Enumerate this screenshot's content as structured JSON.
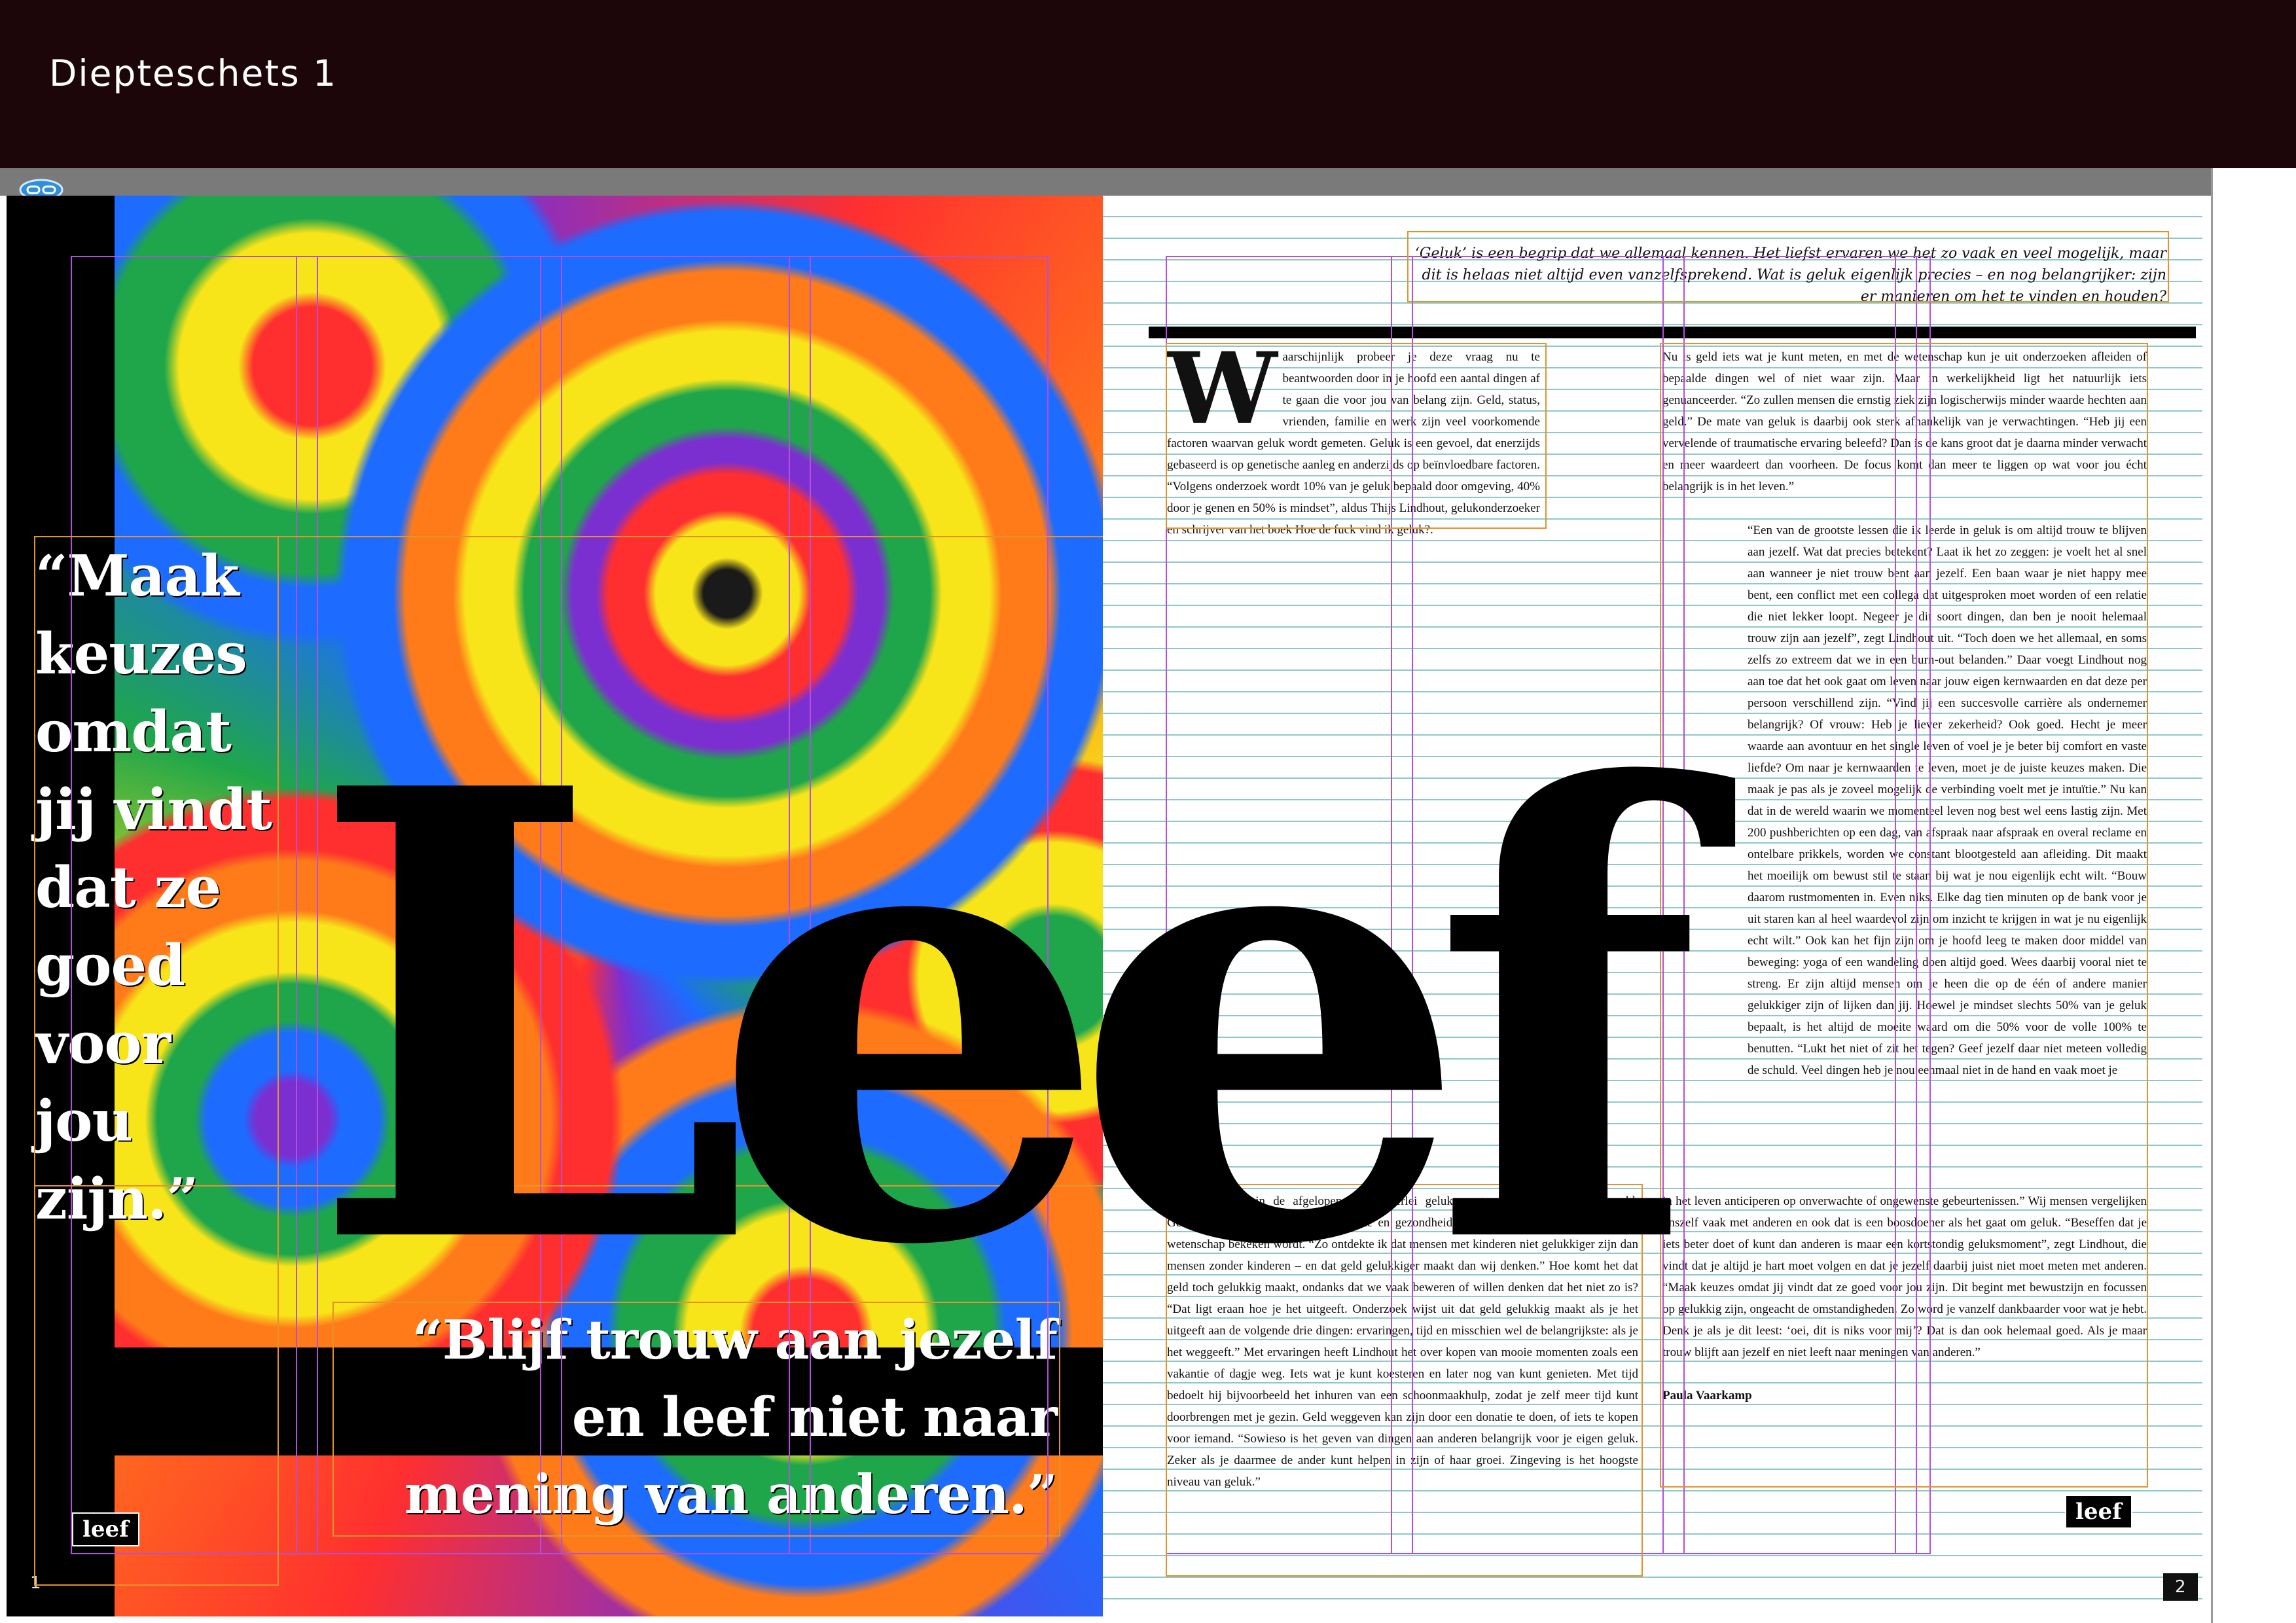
{
  "window": {
    "title": "Diepteschets 1"
  },
  "colors": {
    "titlebar": "#1d0609",
    "guide_purple": "#b04fe0",
    "guide_orange": "#e3932b",
    "baseline_grid": "#8fc8c8"
  },
  "icons": {
    "link": "link-icon"
  },
  "left_page": {
    "quote": "“Maak keuzes omdat jij vindt dat ze goed voor jou zijn.”",
    "quote_bottom": "“Blijf trouw aan jezelf en leef niet naar mening van anderen.”",
    "logo": "leef",
    "page_number": "1"
  },
  "spread": {
    "big_word": "Leef"
  },
  "right_page": {
    "intro": "‘Geluk’ is een begrip dat we allemaal kennen. Het liefst ervaren we het zo vaak en veel mogelijk, maar dit is helaas niet altijd even vanzelfsprekend. Wat is geluk eigenlijk precies – en nog belangrijker: zijn er manieren om het te vinden en houden?",
    "dropcap": "W",
    "col1_top": "aarschijnlijk probeer je deze vraag nu te beantwoorden door in je hoofd een aantal dingen af te gaan die voor jou van belang zijn. Geld, status, vrienden, familie en werk zijn veel voorkomende factoren waarvan geluk wordt gemeten. Geluk is een gevoel, dat enerzijds gebaseerd is op genetische aanleg en anderzijds op beïnvloedbare factoren. “Volgens onderzoek wordt 10% van je geluk bepaald door omgeving, 40% door je genen en 50% is mindset”, aldus Thijs Lindhout, gelukonderzoeker en schrijver van het boek Hoe de fuck vind ik geluk?.",
    "col2_top": "Nu is geld iets wat je kunt meten, en met de wetenschap kun je uit onderzoeken afleiden of bepaalde dingen wel of niet waar zijn. Maar in werkelijkheid ligt het natuurlijk iets genuanceerder. “Zo zullen mensen die ernstig ziek zijn logischerwijs minder waarde hechten aan geld.” De mate van geluk is daarbij ook sterk afhankelijk van je verwachtingen. “Heb jij een vervelende of traumatische ervaring beleefd? Dan is de kans groot dat je daarna minder verwacht en meer waardeert dan voorheen. De focus komt dan meer te liggen op wat voor jou écht belangrijk is in het leven.”",
    "col2_mid": "“Een van de grootste lessen die ik leerde in geluk is om altijd trouw te blijven aan jezelf. Wat dat precies betekent? Laat ik het zo zeggen: je voelt het al snel aan wanneer je niet trouw bent aan jezelf. Een baan waar je niet happy mee bent, een conflict met een collega dat uitgesproken moet worden of een relatie die niet lekker loopt. Negeer je dit soort dingen, dan ben je nooit helemaal trouw zijn aan jezelf”, zegt Lindhout uit. “Toch doen we het allemaal, en soms zelfs zo extreem dat we in een burn-out belanden.” Daar voegt Lindhout nog aan toe dat het ook gaat om leven naar jouw eigen kernwaarden en dat deze per persoon verschillend zijn. “Vind jij een succesvolle carrière als ondernemer belangrijk? Of vrouw: Heb je liever zekerheid? Ook goed. Hecht je meer waarde aan avontuur en het single leven of voel je je beter bij comfort en vaste liefde? Om naar je kernwaarden te leven, moet je de juiste keuzes maken. Die maak je pas als je zoveel mogelijk de verbinding voelt met je intuïtie.” Nu kan dat in de wereld waarin we momenteel leven nog best wel eens lastig zijn. Met 200 pushberichten op een dag, van afspraak naar afspraak en overal reclame en ontelbare prikkels, worden we constant blootgesteld aan afleiding. Dit maakt het moeilijk om bewust stil te staan bij wat je nou eigenlijk echt wilt. “Bouw daarom rustmomenten in. Even niks. Elke dag tien minuten op de bank voor je uit staren kan al heel waardevol zijn om inzicht te krijgen in wat je nu eigenlijk echt wilt.” Ook kan het fijn zijn om je hoofd leeg te maken door middel van beweging: yoga of een wandeling doen altijd goed. Wees daarbij vooral niet te streng. Er zijn altijd mensen om je heen die op de één of andere manier gelukkiger zijn of lijken dan jij. Hoewel je mindset slechts 50% van je geluk bepaalt, is het altijd de moeite waard om die 50% voor de volle 100% te benutten. “Lukt het niet of zit het tegen? Geef jezelf daar niet meteen volledig de schuld. Veel dingen heb je nou eenmaal niet in de hand en vaak moet je",
    "col1_bottom": "Lindhout sprak in de afgelopen jaren allerlei gelukexperts van over de hele wereld. Geluksexperts op het gebied van liefde en gezondheid, maar ook hoe geluk op basis van wetenschap bekeken wordt. “Zo ontdekte ik dat mensen met kinderen niet gelukkiger zijn dan mensen zonder kinderen – en dat geld gelukkiger maakt dan wij denken.” Hoe komt het dat geld toch gelukkig maakt, ondanks dat we vaak beweren of willen denken dat het niet zo is? “Dat ligt eraan hoe je het uitgeeft. Onderzoek wijst uit dat geld gelukkig maakt als je het uitgeeft aan de volgende drie dingen: ervaringen, tijd en misschien wel de belangrijkste: als je het weggeeft.” Met ervaringen heeft Lindhout het over kopen van mooie momenten zoals een vakantie of dagje weg. Iets wat je kunt koesteren en later nog van kunt genieten. Met tijd bedoelt hij bijvoorbeeld het inhuren van een schoonmaakhulp, zodat je zelf meer tijd kunt doorbrengen met je gezin. Geld weggeven kan zijn door een donatie te doen, of iets te kopen voor iemand. “Sowieso is het geven van dingen aan anderen belangrijk voor je eigen geluk. Zeker als je daarmee de ander kunt helpen in zijn of haar groei. Zingeving is het hoogste niveau van geluk.”",
    "col2_bottom": "in het leven anticiperen op onverwachte of ongewenste gebeurtenissen.” Wij mensen vergelijken onszelf vaak met anderen en ook dat is een boosdoener als het gaat om geluk. “Beseffen dat je iets beter doet of kunt dan anderen is maar een kortstondig geluksmoment”, zegt Lindhout, die vindt dat je altijd je hart moet volgen en dat je jezelf daarbij juist niet moet meten met anderen. “Maak keuzes omdat jij vindt dat ze goed voor jou zijn. Dit begint met bewustzijn en focussen op gelukkig zijn, ongeacht de omstandigheden. Zo word je vanzelf dankbaarder voor wat je hebt. Denk je als je dit leest: ‘oei, dit is niks voor mij’? Dat is dan ook helemaal goed. Als je maar trouw blijft aan jezelf en niet leeft naar meningen van anderen.”",
    "author": "Paula Vaarkamp",
    "logo": "leef",
    "page_number": "2"
  }
}
